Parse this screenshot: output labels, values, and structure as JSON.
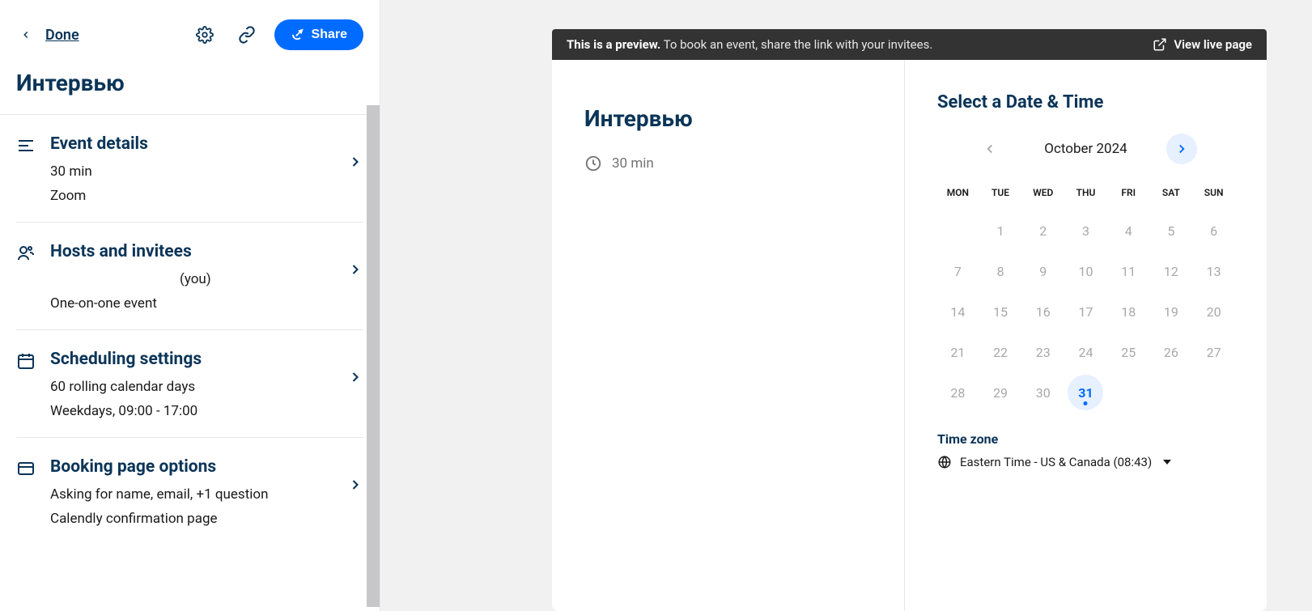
{
  "header": {
    "done": "Done",
    "share": "Share"
  },
  "eventTitle": "Интервью",
  "sections": {
    "eventDetails": {
      "title": "Event details",
      "duration": "30 min",
      "location": "Zoom"
    },
    "hosts": {
      "title": "Hosts and invitees",
      "you": "(you)",
      "type": "One-on-one event"
    },
    "scheduling": {
      "title": "Scheduling settings",
      "range": "60 rolling calendar days",
      "hours": "Weekdays, 09:00 - 17:00"
    },
    "bookingPage": {
      "title": "Booking page options",
      "asking": "Asking for name, email, +1 question",
      "confirmation": "Calendly confirmation page"
    }
  },
  "preview": {
    "bold": "This is a preview.",
    "rest": " To book an event, share the link with your invitees.",
    "viewLive": "View live page"
  },
  "booking": {
    "title": "Интервью",
    "duration": "30 min",
    "selectTitle": "Select a Date & Time",
    "monthLabel": "October 2024",
    "dows": [
      "MON",
      "TUE",
      "WED",
      "THU",
      "FRI",
      "SAT",
      "SUN"
    ],
    "weeks": [
      [
        "",
        "1",
        "2",
        "3",
        "4",
        "5",
        "6"
      ],
      [
        "7",
        "8",
        "9",
        "10",
        "11",
        "12",
        "13"
      ],
      [
        "14",
        "15",
        "16",
        "17",
        "18",
        "19",
        "20"
      ],
      [
        "21",
        "22",
        "23",
        "24",
        "25",
        "26",
        "27"
      ],
      [
        "28",
        "29",
        "30",
        "31",
        "",
        "",
        ""
      ]
    ],
    "availableDay": "31",
    "timezoneTitle": "Time zone",
    "timezoneValue": "Eastern Time - US & Canada (08:43)"
  }
}
